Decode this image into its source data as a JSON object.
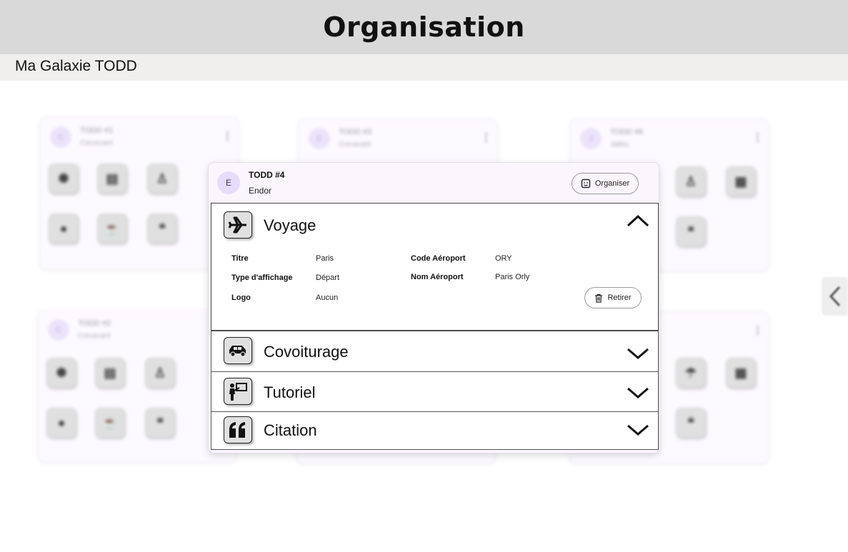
{
  "header": {
    "title": "Organisation"
  },
  "subbar": {
    "breadcrumb": "Ma Galaxie TODD"
  },
  "background_cards": [
    {
      "avatar": "C",
      "title": "TODD #1",
      "subtitle": "Coruscant"
    },
    {
      "avatar": "C",
      "title": "TODD #3",
      "subtitle": "Coruscant"
    },
    {
      "avatar": "J",
      "title": "TODD #6",
      "subtitle": "Jakku"
    },
    {
      "avatar": "C",
      "title": "TODD #2",
      "subtitle": "Coruscant"
    }
  ],
  "dialog": {
    "avatar": "E",
    "title": "TODD #4",
    "subtitle": "Endor",
    "organize_label": "Organiser",
    "sections": [
      {
        "label": "Voyage",
        "icon": "airplane-icon",
        "expanded": true,
        "fields": {
          "titre_label": "Titre",
          "titre_value": "Paris",
          "type_label": "Type d'affichage",
          "type_value": "Départ",
          "logo_label": "Logo",
          "logo_value": "Aucun",
          "code_label": "Code Aéroport",
          "code_value": "ORY",
          "nom_label": "Nom Aéroport",
          "nom_value": "Paris Orly"
        },
        "remove_label": "Retirer"
      },
      {
        "label": "Covoiturage",
        "icon": "car-icon",
        "expanded": false
      },
      {
        "label": "Tutoriel",
        "icon": "presentation-icon",
        "expanded": false
      },
      {
        "label": "Citation",
        "icon": "quote-icon",
        "expanded": false
      }
    ]
  }
}
